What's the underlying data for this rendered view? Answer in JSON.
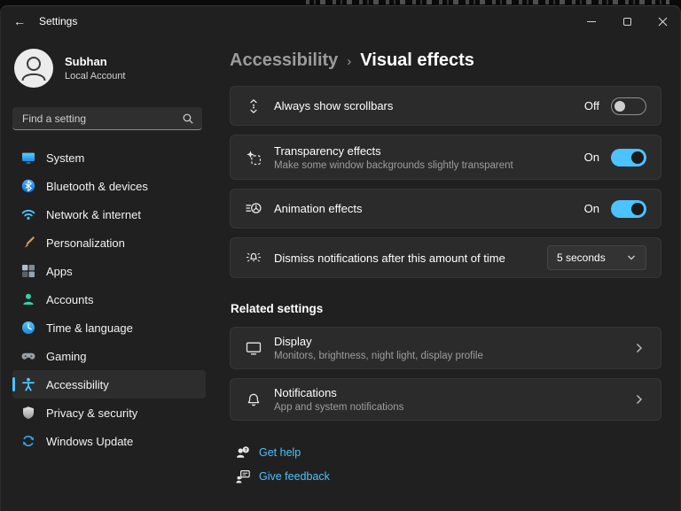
{
  "window": {
    "title": "Settings"
  },
  "sidebar": {
    "user": {
      "name": "Subhan",
      "account_type": "Local Account"
    },
    "search_placeholder": "Find a setting",
    "items": [
      {
        "label": "System",
        "icon": "system-icon"
      },
      {
        "label": "Bluetooth & devices",
        "icon": "bluetooth-icon"
      },
      {
        "label": "Network & internet",
        "icon": "network-icon"
      },
      {
        "label": "Personalization",
        "icon": "personalization-icon"
      },
      {
        "label": "Apps",
        "icon": "apps-icon"
      },
      {
        "label": "Accounts",
        "icon": "accounts-icon"
      },
      {
        "label": "Time & language",
        "icon": "time-language-icon"
      },
      {
        "label": "Gaming",
        "icon": "gaming-icon"
      },
      {
        "label": "Accessibility",
        "icon": "accessibility-icon",
        "selected": true
      },
      {
        "label": "Privacy & security",
        "icon": "privacy-icon"
      },
      {
        "label": "Windows Update",
        "icon": "windows-update-icon"
      }
    ]
  },
  "main": {
    "breadcrumb": {
      "parent": "Accessibility",
      "separator": "›",
      "current": "Visual effects"
    },
    "settings": [
      {
        "title": "Always show scrollbars",
        "icon": "scrollbars-icon",
        "toggle_state": "Off"
      },
      {
        "title": "Transparency effects",
        "subtitle": "Make some window backgrounds slightly transparent",
        "icon": "transparency-icon",
        "toggle_state": "On"
      },
      {
        "title": "Animation effects",
        "icon": "animation-icon",
        "toggle_state": "On"
      },
      {
        "title": "Dismiss notifications after this amount of time",
        "icon": "dismiss-notifications-icon",
        "dropdown_value": "5 seconds"
      }
    ],
    "related": {
      "header": "Related settings",
      "items": [
        {
          "title": "Display",
          "subtitle": "Monitors, brightness, night light, display profile",
          "icon": "display-icon"
        },
        {
          "title": "Notifications",
          "subtitle": "App and system notifications",
          "icon": "notifications-icon"
        }
      ]
    },
    "links": [
      {
        "label": "Get help",
        "icon": "get-help-icon"
      },
      {
        "label": "Give feedback",
        "icon": "give-feedback-icon"
      }
    ]
  },
  "colors": {
    "accent": "#4cc2ff",
    "window_bg": "#202020",
    "card_bg": "#2b2b2b",
    "link": "#4cc2ff"
  }
}
